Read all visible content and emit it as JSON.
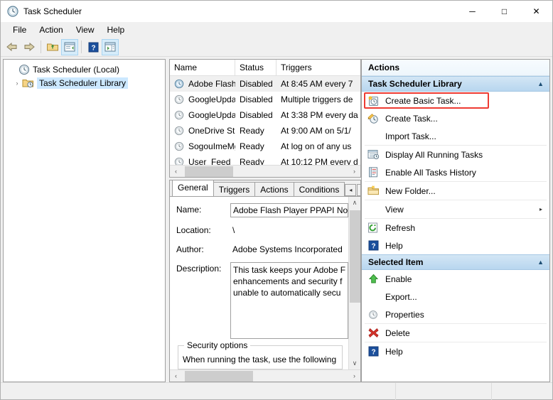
{
  "window": {
    "title": "Task Scheduler",
    "app_icon": "clock-icon",
    "controls": {
      "minimize": "─",
      "maximize": "□",
      "close": "✕"
    }
  },
  "menubar": {
    "items": [
      "File",
      "Action",
      "View",
      "Help"
    ]
  },
  "toolbar": {
    "buttons": [
      {
        "name": "back-button",
        "icon": "arrow-left-icon"
      },
      {
        "name": "forward-button",
        "icon": "arrow-right-icon"
      },
      {
        "name": "up-folder-button",
        "icon": "folder-up-icon"
      },
      {
        "name": "show-hide-console-tree-button",
        "icon": "console-tree-icon"
      },
      {
        "name": "help-button",
        "icon": "help-question-icon"
      },
      {
        "name": "show-hide-action-pane-button",
        "icon": "action-pane-icon"
      }
    ]
  },
  "tree": {
    "root": {
      "label": "Task Scheduler (Local)",
      "icon": "clock-icon"
    },
    "child": {
      "label": "Task Scheduler Library",
      "icon": "folder-clock-icon",
      "twisty": "›",
      "selected": true
    }
  },
  "tasklist": {
    "columns": [
      "Name",
      "Status",
      "Triggers"
    ],
    "rows": [
      {
        "name": "Adobe Flash...",
        "status": "Disabled",
        "trigger": "At 8:45 AM every 7",
        "selected": true
      },
      {
        "name": "GoogleUpda...",
        "status": "Disabled",
        "trigger": "Multiple triggers de",
        "selected": false
      },
      {
        "name": "GoogleUpda...",
        "status": "Disabled",
        "trigger": "At 3:38 PM every da",
        "selected": false
      },
      {
        "name": "OneDrive St...",
        "status": "Ready",
        "trigger": "At 9:00 AM on 5/1/",
        "selected": false
      },
      {
        "name": "SogouImeMgr",
        "status": "Ready",
        "trigger": "At log on of any us",
        "selected": false
      },
      {
        "name": "User_Feed_S...",
        "status": "Ready",
        "trigger": "At 10:12 PM every d",
        "selected": false
      }
    ],
    "hscroll": {
      "left_arrow": "‹",
      "right_arrow": "›"
    }
  },
  "detail": {
    "tabs": [
      {
        "label": "General",
        "active": true
      },
      {
        "label": "Triggers",
        "active": false
      },
      {
        "label": "Actions",
        "active": false
      },
      {
        "label": "Conditions",
        "active": false
      }
    ],
    "tab_nav": {
      "prev": "◂",
      "next": "▸"
    },
    "fields": {
      "name_label": "Name:",
      "name_value": "Adobe Flash Player PPAPI Not",
      "location_label": "Location:",
      "location_value": "\\",
      "author_label": "Author:",
      "author_value": "Adobe Systems Incorporated",
      "description_label": "Description:",
      "description_lines": [
        "This task keeps your Adobe F",
        "enhancements and security f",
        "unable to automatically secu"
      ]
    },
    "security_options": {
      "title": "Security options",
      "line": "When running the task, use the following u"
    },
    "scrollbars": {
      "up_arrow": "∧",
      "down_arrow": "∨",
      "left_arrow": "‹",
      "right_arrow": "›"
    }
  },
  "actions_pane": {
    "title": "Actions",
    "sections": [
      {
        "name": "task-scheduler-library",
        "label": "Task Scheduler Library",
        "collapse_icon": "▲",
        "items": [
          {
            "label": "Create Basic Task...",
            "icon": "create-basic-task-icon",
            "highlighted": true,
            "sep_after": false
          },
          {
            "label": "Create Task...",
            "icon": "create-task-icon",
            "sep_after": false
          },
          {
            "label": "Import Task...",
            "icon": "none",
            "sep_after": true
          },
          {
            "label": "Display All Running Tasks",
            "icon": "running-tasks-icon",
            "sep_after": false
          },
          {
            "label": "Enable All Tasks History",
            "icon": "tasks-history-icon",
            "sep_after": true
          },
          {
            "label": "New Folder...",
            "icon": "new-folder-icon",
            "sep_after": true
          },
          {
            "label": "View",
            "icon": "none",
            "submenu": "▸",
            "sep_after": true
          },
          {
            "label": "Refresh",
            "icon": "refresh-icon",
            "sep_after": false
          },
          {
            "label": "Help",
            "icon": "help-question-icon",
            "sep_after": false
          }
        ]
      },
      {
        "name": "selected-item",
        "label": "Selected Item",
        "collapse_icon": "▲",
        "items": [
          {
            "label": "Enable",
            "icon": "green-up-arrow-icon",
            "sep_after": false
          },
          {
            "label": "Export...",
            "icon": "none",
            "sep_after": false
          },
          {
            "label": "Properties",
            "icon": "clock-icon",
            "sep_after": true
          },
          {
            "label": "Delete",
            "icon": "red-x-icon",
            "sep_after": true
          },
          {
            "label": "Help",
            "icon": "help-question-icon",
            "sep_after": false
          }
        ]
      }
    ]
  },
  "colors": {
    "highlight_red": "#ee3b33",
    "selection_blue": "#cce8ff",
    "section_header_blue": "#b8d6ef",
    "delete_red": "#d32f2f",
    "enable_green": "#4caf50"
  },
  "statusbar": {
    "panes": [
      "",
      "",
      ""
    ]
  }
}
